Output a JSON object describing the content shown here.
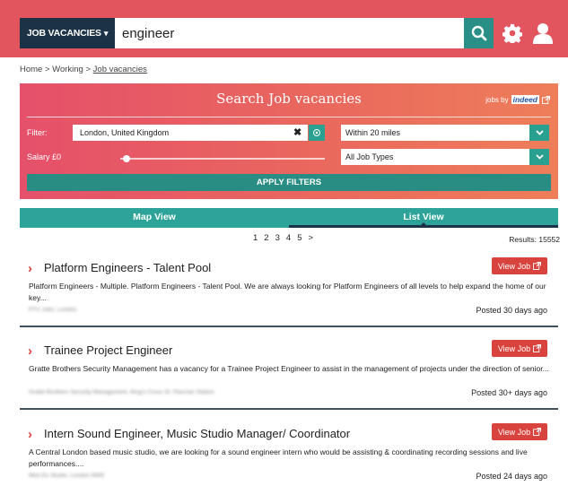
{
  "header": {
    "jobs_menu_label": "JOB VACANCIES",
    "jobs_menu_caret": "▾",
    "search_value": "engineer",
    "icons": [
      "search-icon",
      "gear-icon",
      "user-icon"
    ]
  },
  "breadcrumb": {
    "home": "Home",
    "separator1": " > ",
    "working": "Working",
    "separator2": " > ",
    "current": "Job vacancies"
  },
  "search_panel": {
    "title": "Search Job vacancies",
    "powered_prefix": "jobs by",
    "powered_brand": "indeed",
    "filter_label": "Filter:",
    "location_value": "London, United Kingdom",
    "distance_value": "Within 20 miles",
    "salary_label": "Salary £0",
    "job_type_value": "All Job Types",
    "apply_label": "APPLY FILTERS"
  },
  "tabs": [
    {
      "label": "Map View",
      "active": false
    },
    {
      "label": "List View",
      "active": true
    }
  ],
  "pagination": {
    "pages": [
      "1",
      "2",
      "3",
      "4",
      "5"
    ],
    "next": ">"
  },
  "results_label": "Results: 15552",
  "jobs": [
    {
      "title": "Platform Engineers - Talent Pool",
      "view_label": "View Job",
      "description": "Platform Engineers - Multiple. Platform Engineers - Talent Pool. We are always looking for Platform Engineers of all levels to help expand the home of our key...",
      "company": "PTV Jobs, London",
      "posted": "Posted 30 days ago"
    },
    {
      "title": "Trainee Project Engineer",
      "view_label": "View Job",
      "description": "Gratte Brothers Security Management has a vacancy for a Trainee Project Engineer to assist in the management of projects under the direction of senior...",
      "company": "Gratte Brothers Security Management, King's Cross St. Pancras Station",
      "posted": "Posted 30+ days ago"
    },
    {
      "title": "Intern Sound Engineer, Music Studio Manager/ Coordinator",
      "view_label": "View Job",
      "description": "A Central London based music studio, we are looking for a sound engineer intern who would be assisting & coordinating recording sessions and live performances....",
      "company": "Mint Du Studio, London NW6",
      "posted": "Posted 24 days ago"
    }
  ],
  "colors": {
    "header_bg": "#e2545e",
    "navy": "#1c3246",
    "teal": "#2a8f86",
    "accent_red": "#d9433e"
  }
}
